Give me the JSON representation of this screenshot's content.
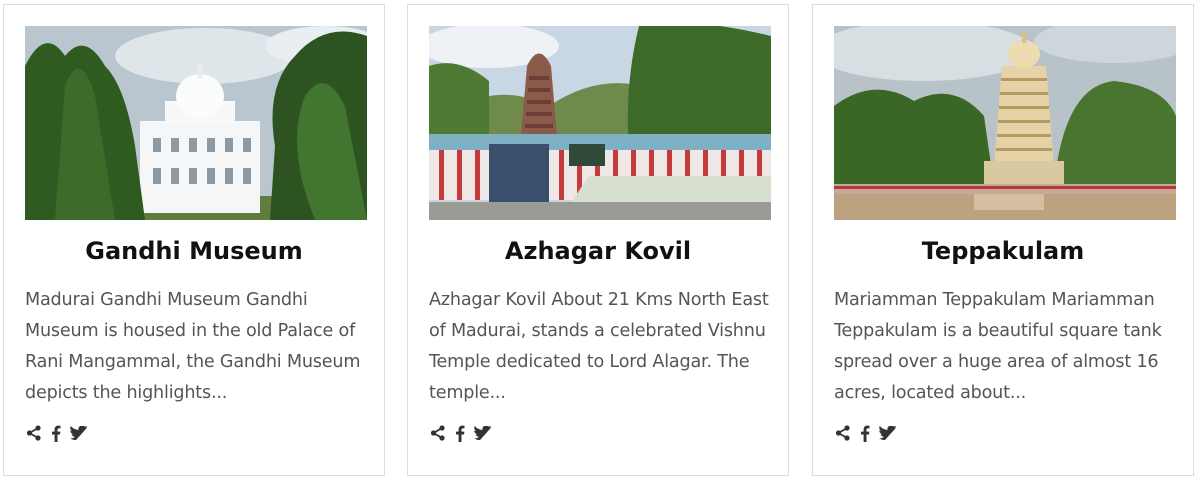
{
  "cards": [
    {
      "title": "Gandhi Museum",
      "description": "Madurai Gandhi Museum Gandhi Museum is housed in the old Palace of Rani Mangammal, the Gandhi Museum depicts the highlights..."
    },
    {
      "title": "Azhagar Kovil",
      "description": "Azhagar Kovil About 21 Kms North East of Madurai, stands a celebrated Vishnu Temple dedicated to Lord Alagar. The temple..."
    },
    {
      "title": "Teppakulam",
      "description": "Mariamman Teppakulam Mariamman Teppakulam is a beautiful square tank spread over a huge area of almost 16 acres, located about..."
    }
  ],
  "icons": {
    "share": "share-icon",
    "facebook": "facebook-icon",
    "twitter": "twitter-icon"
  },
  "colors": {
    "text": "#555555",
    "title": "#111111",
    "icon": "#333333",
    "border": "#dcdcdc"
  }
}
